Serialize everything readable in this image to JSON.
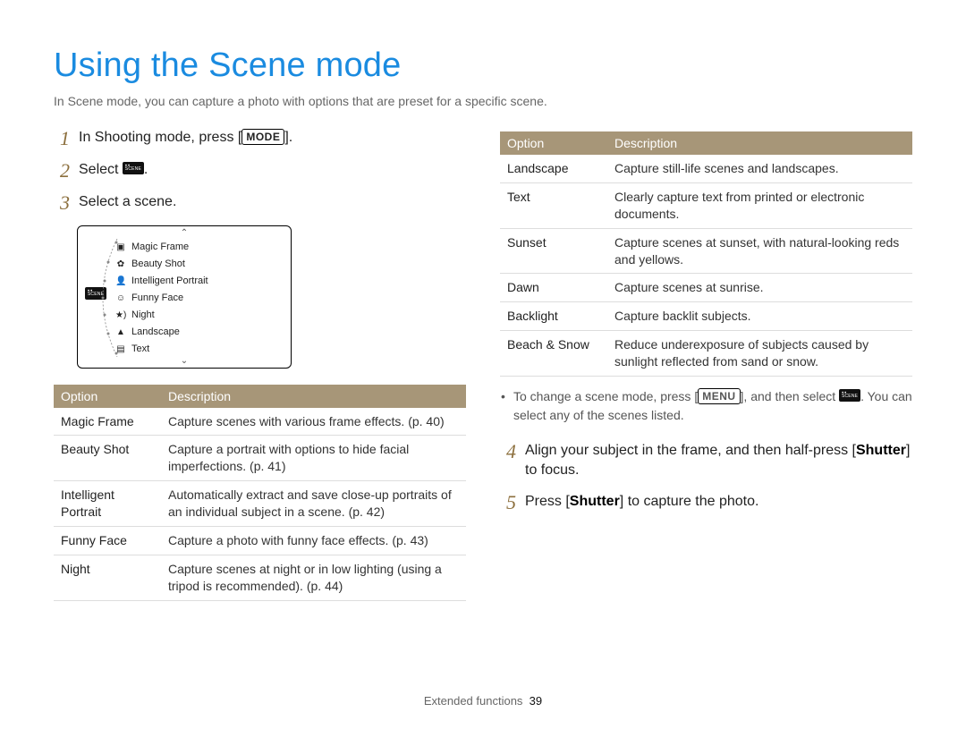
{
  "title": "Using the Scene mode",
  "intro": "In Scene mode, you can capture a photo with options that are preset for a specific scene.",
  "steps": {
    "s1_a": "In Shooting mode, press [",
    "s1_mode": "MODE",
    "s1_b": "].",
    "s2_a": "Select ",
    "s2_b": ".",
    "s3": "Select a scene.",
    "s4_a": "Align your subject in the frame, and then half-press [",
    "s4_shutter": "Shutter",
    "s4_b": "] to focus.",
    "s5_a": "Press [",
    "s5_shutter": "Shutter",
    "s5_b": "] to capture the photo."
  },
  "scene_menu": {
    "items": [
      "Magic Frame",
      "Beauty Shot",
      "Intelligent Portrait",
      "Funny Face",
      "Night",
      "Landscape",
      "Text"
    ]
  },
  "note": {
    "a": "To change a scene mode, press [",
    "menu": "MENU",
    "b": "], and then select ",
    "c": ". You can select any of the scenes listed."
  },
  "tables": {
    "left": {
      "h1": "Option",
      "h2": "Description",
      "rows": [
        {
          "o": "Magic Frame",
          "d": "Capture scenes with various frame effects. (p. 40)"
        },
        {
          "o": "Beauty Shot",
          "d": "Capture a portrait with options to hide facial imperfections. (p. 41)"
        },
        {
          "o": "Intelligent Portrait",
          "d": "Automatically extract and save close-up portraits of an individual subject in a scene. (p. 42)"
        },
        {
          "o": "Funny Face",
          "d": "Capture a photo with funny face effects. (p. 43)"
        },
        {
          "o": "Night",
          "d": "Capture scenes at night or in low lighting (using a tripod is recommended). (p. 44)"
        }
      ]
    },
    "right": {
      "h1": "Option",
      "h2": "Description",
      "rows": [
        {
          "o": "Landscape",
          "d": "Capture still-life scenes and landscapes."
        },
        {
          "o": "Text",
          "d": "Clearly capture text from printed or electronic documents."
        },
        {
          "o": "Sunset",
          "d": "Capture scenes at sunset, with natural-looking reds and yellows."
        },
        {
          "o": "Dawn",
          "d": "Capture scenes at sunrise."
        },
        {
          "o": "Backlight",
          "d": "Capture backlit subjects."
        },
        {
          "o": "Beach & Snow",
          "d": "Reduce underexposure of subjects caused by sunlight reflected from sand or snow."
        }
      ]
    }
  },
  "footer": {
    "section": "Extended functions",
    "page": "39"
  }
}
